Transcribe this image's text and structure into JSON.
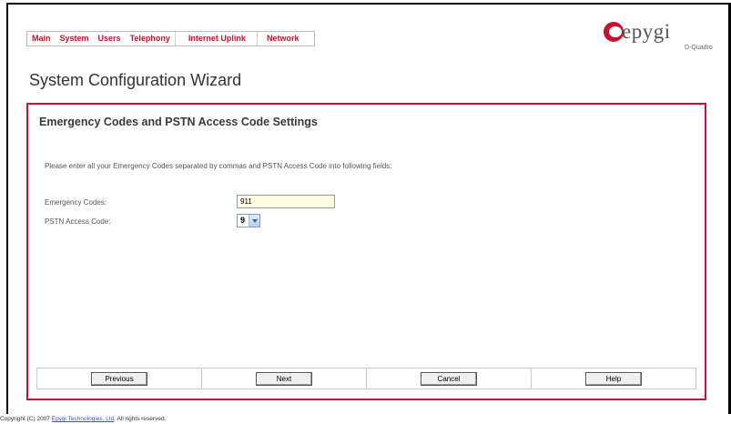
{
  "menu": {
    "items": [
      {
        "label": "Main"
      },
      {
        "label": "System"
      },
      {
        "label": "Users"
      },
      {
        "label": "Telephony"
      },
      {
        "label": "Internet Uplink"
      },
      {
        "label": "Network"
      }
    ]
  },
  "logo": {
    "brand": "epygi",
    "sub": "D-Quadro"
  },
  "page_title": "System Configuration Wizard",
  "wizard": {
    "section_title": "Emergency Codes and PSTN Access Code Settings",
    "intro": "Please enter all your Emergency Codes separated by commas and PSTN Access Code into following fields:",
    "emergency_codes": {
      "label": "Emergency Codes:",
      "value": "911"
    },
    "pstn_access_code": {
      "label": "PSTN Access Code:",
      "selected": "9"
    },
    "buttons": {
      "previous": "Previous",
      "next": "Next",
      "cancel": "Cancel",
      "help": "Help"
    }
  },
  "footer": {
    "prefix": "Copyright (C) 2007 ",
    "company_link": "Epygi Technologies, Ltd",
    "suffix": ". All rights reserved."
  },
  "colors": {
    "accent_red": "#d0102a",
    "menu_text": "#c0152a",
    "input_bg": "#fffde0"
  }
}
